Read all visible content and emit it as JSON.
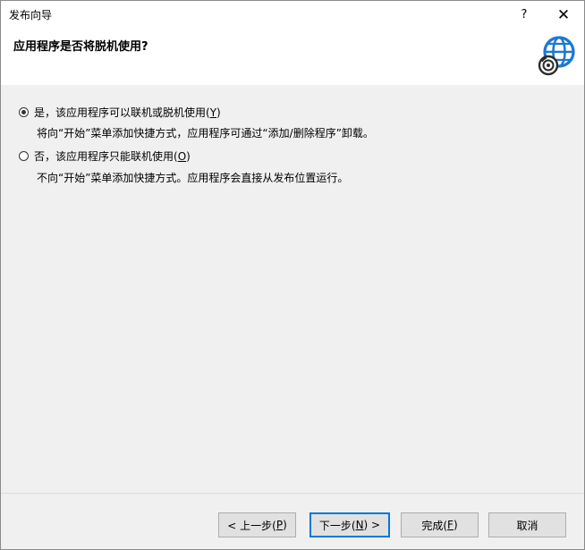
{
  "window": {
    "title": "发布向导",
    "help_glyph": "?",
    "close_glyph": "✕"
  },
  "header": {
    "title": "应用程序是否将脱机使用?",
    "icon": "globe-cd-icon"
  },
  "options": [
    {
      "label_prefix": "是，该应用程序可以联机或脱机使用(",
      "accel": "Y",
      "label_suffix": ")",
      "description": "将向“开始”菜单添加快捷方式，应用程序可通过“添加/删除程序”卸载。",
      "selected": true
    },
    {
      "label_prefix": "否，该应用程序只能联机使用(",
      "accel": "O",
      "label_suffix": ")",
      "description": "不向“开始”菜单添加快捷方式。应用程序会直接从发布位置运行。",
      "selected": false
    }
  ],
  "buttons": {
    "back": {
      "prefix": "< 上一步(",
      "accel": "P",
      "suffix": ")"
    },
    "next": {
      "prefix": "下一步(",
      "accel": "N",
      "suffix": ") >"
    },
    "finish": {
      "prefix": "完成(",
      "accel": "F",
      "suffix": ")"
    },
    "cancel": {
      "label": "取消"
    }
  },
  "colors": {
    "accent": "#0078d7",
    "panel": "#f0f0f0"
  }
}
